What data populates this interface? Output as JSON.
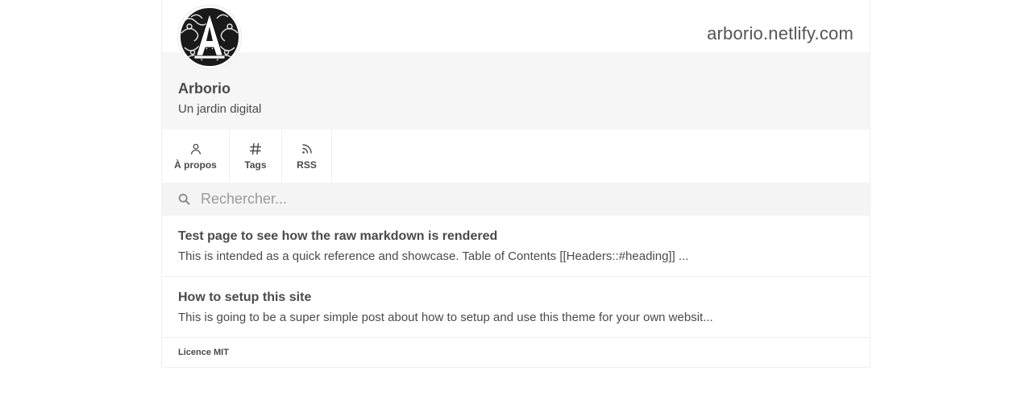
{
  "site": {
    "url": "arborio.netlify.com",
    "name": "Arborio",
    "tagline": "Un jardin digital",
    "avatar_icon": "ornate-letter-a-logo",
    "avatar_letter": "A"
  },
  "nav": {
    "items": [
      {
        "label": "À propos",
        "icon": "user-icon"
      },
      {
        "label": "Tags",
        "icon": "hash-icon"
      },
      {
        "label": "RSS",
        "icon": "rss-icon"
      }
    ]
  },
  "search": {
    "placeholder": "Rechercher...",
    "value": "",
    "icon": "search-icon"
  },
  "posts": [
    {
      "title": "Test page to see how the raw markdown is rendered",
      "excerpt": "This is intended as a quick reference and showcase. Table of Contents [[Headers::#heading]] ..."
    },
    {
      "title": "How to setup this site",
      "excerpt": "This is going to be a super simple post about how to setup and use this theme for your own websit..."
    }
  ],
  "footer": {
    "license": "Licence MIT"
  },
  "colors": {
    "text": "#4a4a4a",
    "panel": "#f6f6f6",
    "search_bg": "#f4f4f4",
    "border": "#efefef"
  }
}
